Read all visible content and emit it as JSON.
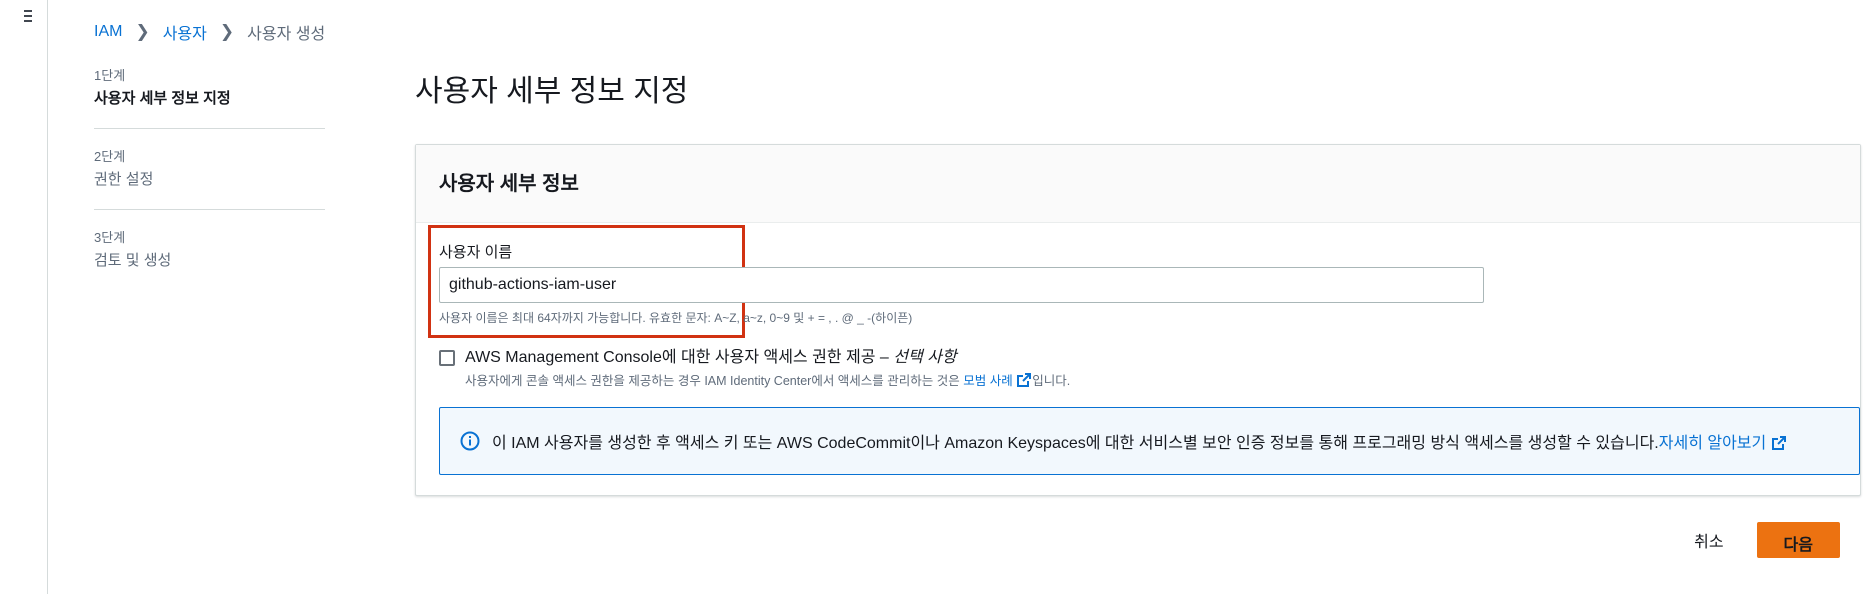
{
  "breadcrumb": {
    "items": [
      "IAM",
      "사용자"
    ],
    "current": "사용자 생성"
  },
  "steps": [
    {
      "num": "1단계",
      "title": "사용자 세부 정보 지정",
      "active": true
    },
    {
      "num": "2단계",
      "title": "권한 설정",
      "active": false
    },
    {
      "num": "3단계",
      "title": "검토 및 생성",
      "active": false
    }
  ],
  "page_title": "사용자 세부 정보 지정",
  "container": {
    "header": "사용자 세부 정보",
    "username": {
      "label": "사용자 이름",
      "value": "github-actions-iam-user",
      "hint": "사용자 이름은 최대 64자까지 가능합니다. 유효한 문자: A~Z, a~z, 0~9 및 + = , . @ _ -(하이픈)"
    },
    "console_access": {
      "label": "AWS Management Console에 대한 사용자 액세스 권한 제공 – ",
      "optional": "선택 사항",
      "desc_before": "사용자에게 콘솔 액세스 권한을 제공하는 경우 IAM Identity Center에서 액세스를 관리하는 것은 ",
      "desc_link": "모범 사례",
      "desc_after": "입니다.",
      "checked": false
    },
    "info": {
      "text": "이 IAM 사용자를 생성한 후 액세스 키 또는 AWS CodeCommit이나 Amazon Keyspaces에 대한 서비스별 보안 인증 정보를 통해 프로그래밍 방식 액세스를 생성할 수 있습니다. ",
      "link": "자세히 알아보기"
    }
  },
  "actions": {
    "cancel": "취소",
    "next": "다음"
  },
  "colors": {
    "link": "#0972d3",
    "primary_button": "#ec7211",
    "highlight": "#d13212",
    "info_border": "#0972d3"
  }
}
